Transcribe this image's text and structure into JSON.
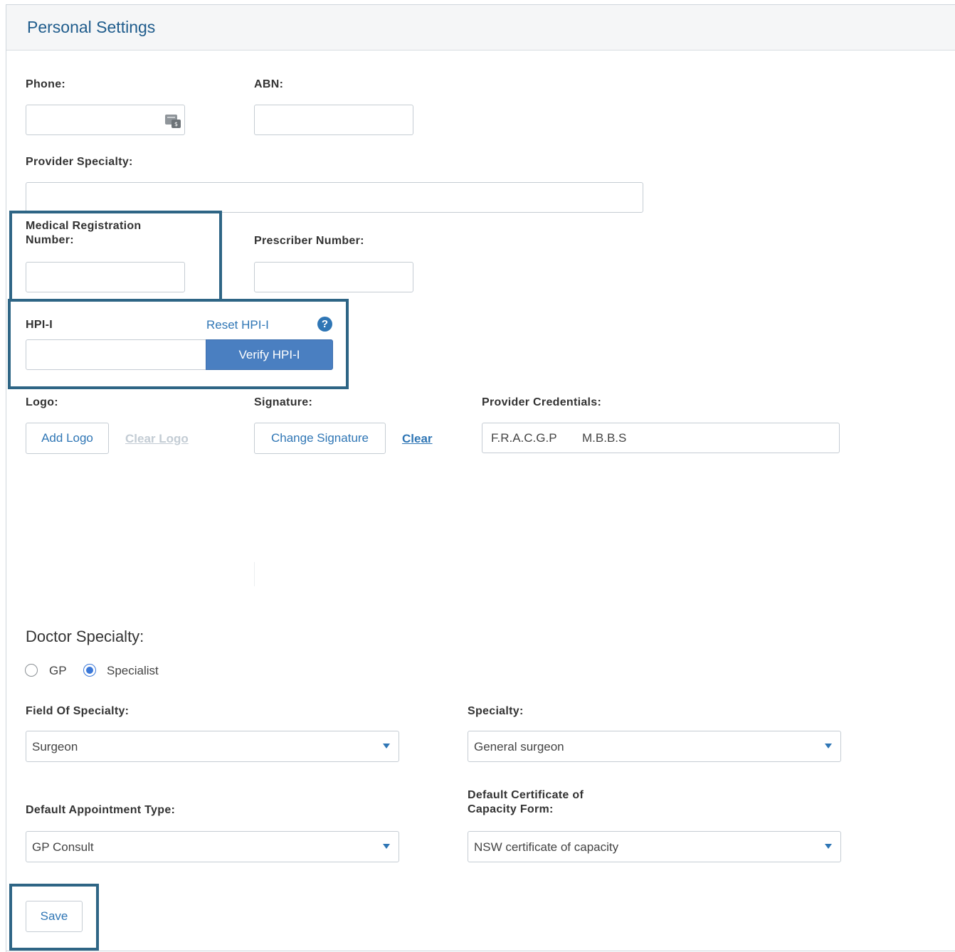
{
  "header": {
    "title": "Personal Settings"
  },
  "fields": {
    "phone": {
      "label": "Phone:",
      "value": ""
    },
    "abn": {
      "label": "ABN:",
      "value": ""
    },
    "provider_specialty": {
      "label": "Provider Specialty:",
      "value": ""
    },
    "medical_registration": {
      "label_line1": "Medical Registration",
      "label_line2": "Number:",
      "value": ""
    },
    "prescriber_number": {
      "label": "Prescriber Number:",
      "value": ""
    },
    "hpii": {
      "label": "HPI-I",
      "value": "",
      "reset_label": "Reset HPI-I",
      "verify_label": "Verify HPI-I",
      "help_glyph": "?"
    }
  },
  "logo": {
    "label": "Logo:",
    "add_label": "Add Logo",
    "clear_label": "Clear Logo"
  },
  "signature": {
    "label": "Signature:",
    "change_label": "Change Signature",
    "clear_label": "Clear"
  },
  "credentials": {
    "label": "Provider Credentials:",
    "values": [
      "F.R.A.C.G.P",
      "M.B.B.S"
    ]
  },
  "doctor_specialty": {
    "title": "Doctor Specialty:",
    "options": [
      {
        "label": "GP",
        "checked": false
      },
      {
        "label": "Specialist",
        "checked": true
      }
    ]
  },
  "selects": {
    "field_of_specialty": {
      "label": "Field Of Specialty:",
      "value": "Surgeon"
    },
    "specialty": {
      "label": "Specialty:",
      "value": "General surgeon"
    },
    "default_appointment_type": {
      "label": "Default Appointment Type:",
      "value": "GP Consult"
    },
    "default_certificate": {
      "label_line1": "Default Certificate of",
      "label_line2": "Capacity Form:",
      "value": "NSW certificate of capacity"
    }
  },
  "save_label": "Save",
  "icons": {
    "phone": "phone-card-icon",
    "help": "question-circle-icon",
    "dropdown": "caret-down-icon"
  },
  "colors": {
    "accent": "#2f76b5",
    "title": "#1f5c8c",
    "highlight_border": "#2e6585",
    "verify_button": "#4a7fc1",
    "radio_selected": "#3b78d8"
  }
}
